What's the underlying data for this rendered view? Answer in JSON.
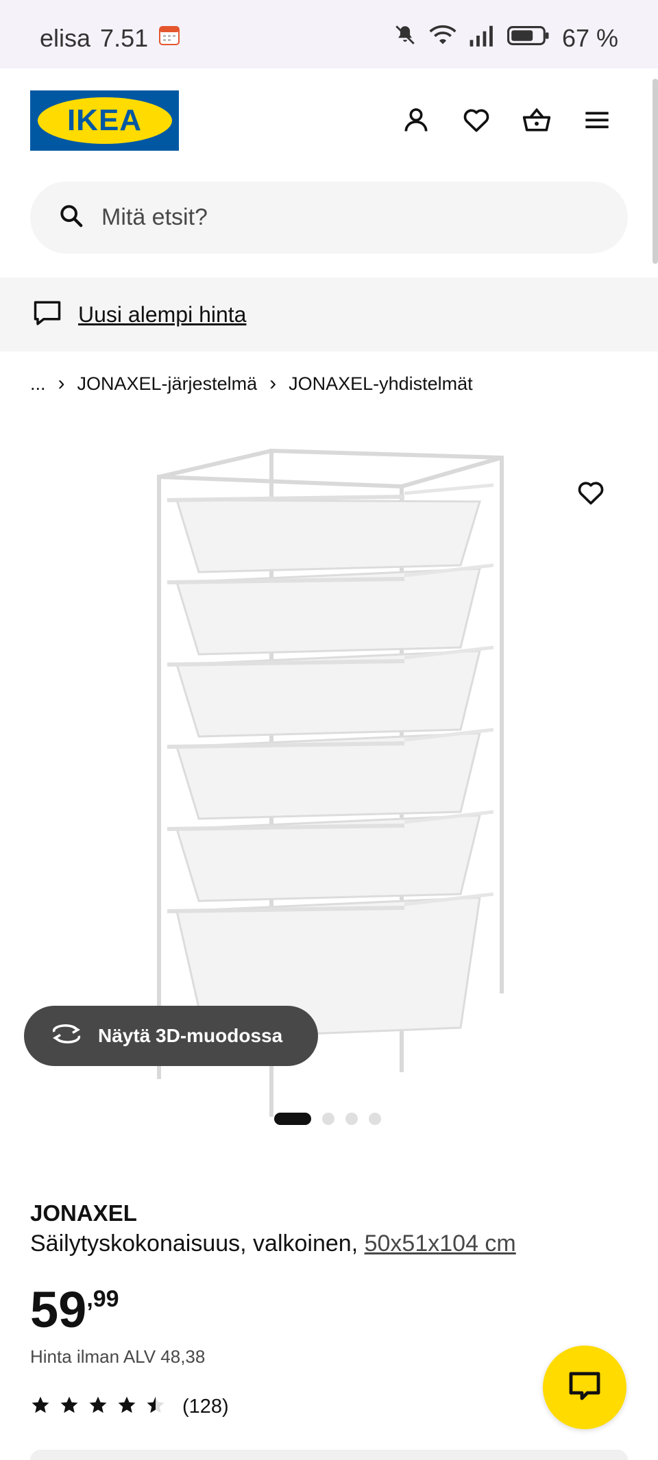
{
  "status_bar": {
    "carrier": "elisa",
    "time": "7.51",
    "battery": "67 %"
  },
  "brand": {
    "logo_text": "IKEA",
    "colors": {
      "blue": "#0058a3",
      "yellow": "#ffdb00"
    }
  },
  "header": {
    "icons": [
      "user-icon",
      "heart-icon",
      "basket-icon",
      "menu-icon"
    ]
  },
  "search": {
    "placeholder": "Mitä etsit?"
  },
  "notice": {
    "text": "Uusi alempi hinta"
  },
  "breadcrumb": {
    "items": [
      "...",
      "JONAXEL-järjestelmä",
      "JONAXEL-yhdistelmät"
    ]
  },
  "gallery": {
    "view_3d_label": "Näytä 3D-muodossa",
    "pages": 4,
    "active_page": 1
  },
  "product": {
    "name": "JONAXEL",
    "description": "Säilytyskokonaisuus, valkoinen,",
    "dimensions": "50x51x104 cm",
    "price_integer": "59",
    "price_decimal": ",99",
    "price_ex_vat": "Hinta ilman ALV 48,38",
    "rating_value": 4.5,
    "rating_max": 5,
    "review_count": "(128)"
  }
}
